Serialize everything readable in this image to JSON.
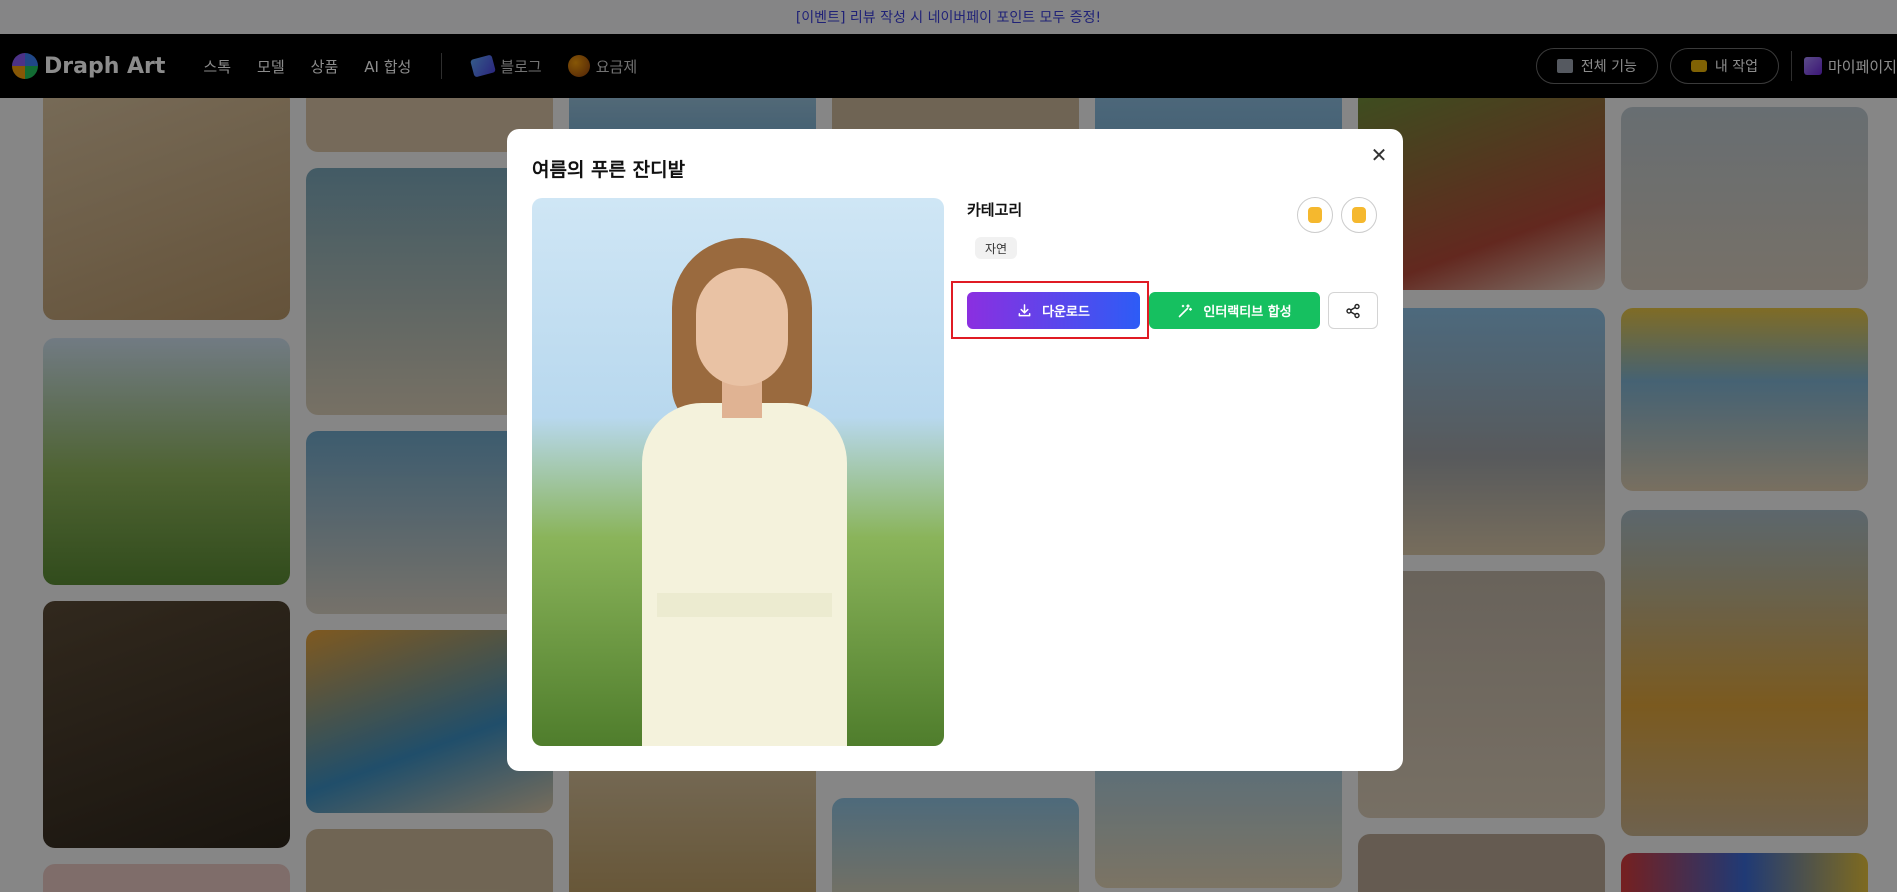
{
  "banner": {
    "text": "[이벤트] 리뷰 작성 시 네이버페이 포인트 모두 증정!"
  },
  "header": {
    "logo_text": "Draph Art",
    "nav": [
      "스톡",
      "모델",
      "상품",
      "AI 합성"
    ],
    "nav_secondary": [
      {
        "label": "블로그",
        "icon": "book-icon"
      },
      {
        "label": "요금제",
        "icon": "ball-icon"
      }
    ],
    "right": {
      "all_features": "전체 기능",
      "my_work": "내 작업",
      "my_page": "마이페이지"
    }
  },
  "modal": {
    "title": "여름의 푸른 잔디밭",
    "category_label": "카테고리",
    "category_tag": "자연",
    "download_label": "다운로드",
    "compose_label": "인터랙티브 합성",
    "colors": {
      "download_start": "#8b2fe0",
      "download_end": "#2d5cf6",
      "compose": "#16c060",
      "highlight": "#e01b24"
    }
  }
}
